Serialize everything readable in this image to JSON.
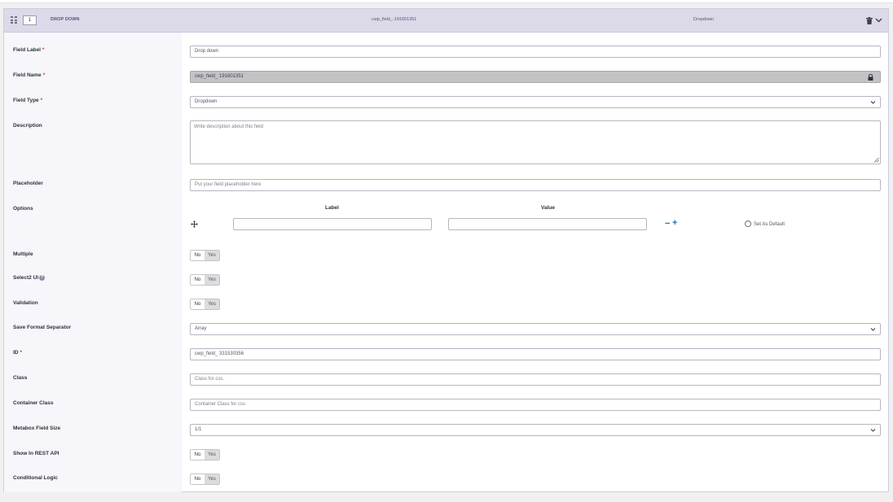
{
  "header": {
    "order": "1",
    "title": "DROP DOWN",
    "field_name": "cwp_field_-191601351",
    "field_type": "Dropdown"
  },
  "fields": {
    "field_label": {
      "label": "Field Label",
      "required": "*",
      "value": "Drop down"
    },
    "field_name": {
      "label": "Field Name",
      "required": "*",
      "value": "cwp_field_ 191601351"
    },
    "field_type": {
      "label": "Field Type",
      "required": "*",
      "value": "Dropdown"
    },
    "description": {
      "label": "Description",
      "placeholder": "Write description about this field"
    },
    "placeholder": {
      "label": "Placeholder",
      "placeholder": "Put your field placeholder here"
    },
    "options": {
      "label": "Options",
      "col_label": "Label",
      "col_value": "Value",
      "minus": "−",
      "plus": "+",
      "set_default": "Set As Default"
    },
    "multiple": {
      "label": "Multiple",
      "no": "No",
      "yes": "Yes"
    },
    "select2": {
      "label": "Select2 UI",
      "help": "?",
      "no": "No",
      "yes": "Yes"
    },
    "validation": {
      "label": "Validation",
      "no": "No",
      "yes": "Yes"
    },
    "save_format": {
      "label": "Save Format Separator",
      "value": "Array"
    },
    "id": {
      "label": "ID",
      "required": "*",
      "value": "cwp_field_ 331530356"
    },
    "class": {
      "label": "Class",
      "placeholder": "Class for css."
    },
    "container_class": {
      "label": "Container Class",
      "placeholder": "Container Class for css"
    },
    "metabox_size": {
      "label": "Metabox Field Size",
      "value": "1/1"
    },
    "rest_api": {
      "label": "Show In REST API",
      "no": "No",
      "yes": "Yes"
    },
    "conditional": {
      "label": "Conditional Logic",
      "no": "No",
      "yes": "Yes"
    }
  },
  "icons": {
    "drag": "grip-icon",
    "delete": "trash-icon",
    "collapse": "chevron-down-icon",
    "lock": "lock-icon",
    "move": "move-icon"
  },
  "colors": {
    "header_bg": "#dcdae9",
    "accent": "#2271b1",
    "required": "#d63638"
  }
}
